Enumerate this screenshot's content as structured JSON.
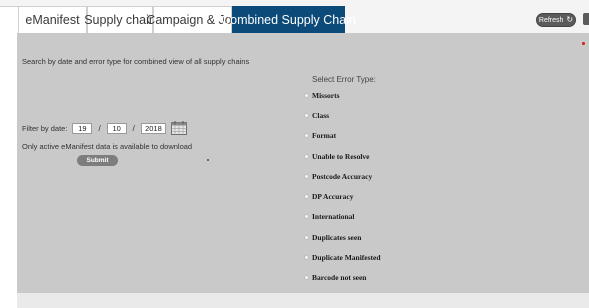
{
  "tabs": [
    {
      "label": "eManifest",
      "active": false
    },
    {
      "label": "Supply chain",
      "active": false
    },
    {
      "label": "Campaign & Job",
      "active": false
    },
    {
      "label": "Combined Supply Chain",
      "active": true
    }
  ],
  "toolbar": {
    "refresh_label": "Refresh",
    "refresh_icon": "↻"
  },
  "colors": {
    "active_tab": "#0c4a7a",
    "panel": "#c9c9c9",
    "alert_dot": "#d21b1b"
  },
  "intro_text": "Search by date and error type for combined view of all supply chains",
  "filter": {
    "label": "Filter by date:",
    "day": "19",
    "month": "10",
    "year": "2018",
    "separator": "/"
  },
  "note": "Only active eManifest data is available to download",
  "submit_label": "Submit",
  "error_type": {
    "title": "Select Error Type:",
    "options": [
      "Missorts",
      "Class",
      "Format",
      "Unable to Resolve",
      "Postcode Accuracy",
      "DP Accuracy",
      "International",
      "Duplicates seen",
      "Duplicate Manifested",
      "Barcode not seen"
    ]
  }
}
